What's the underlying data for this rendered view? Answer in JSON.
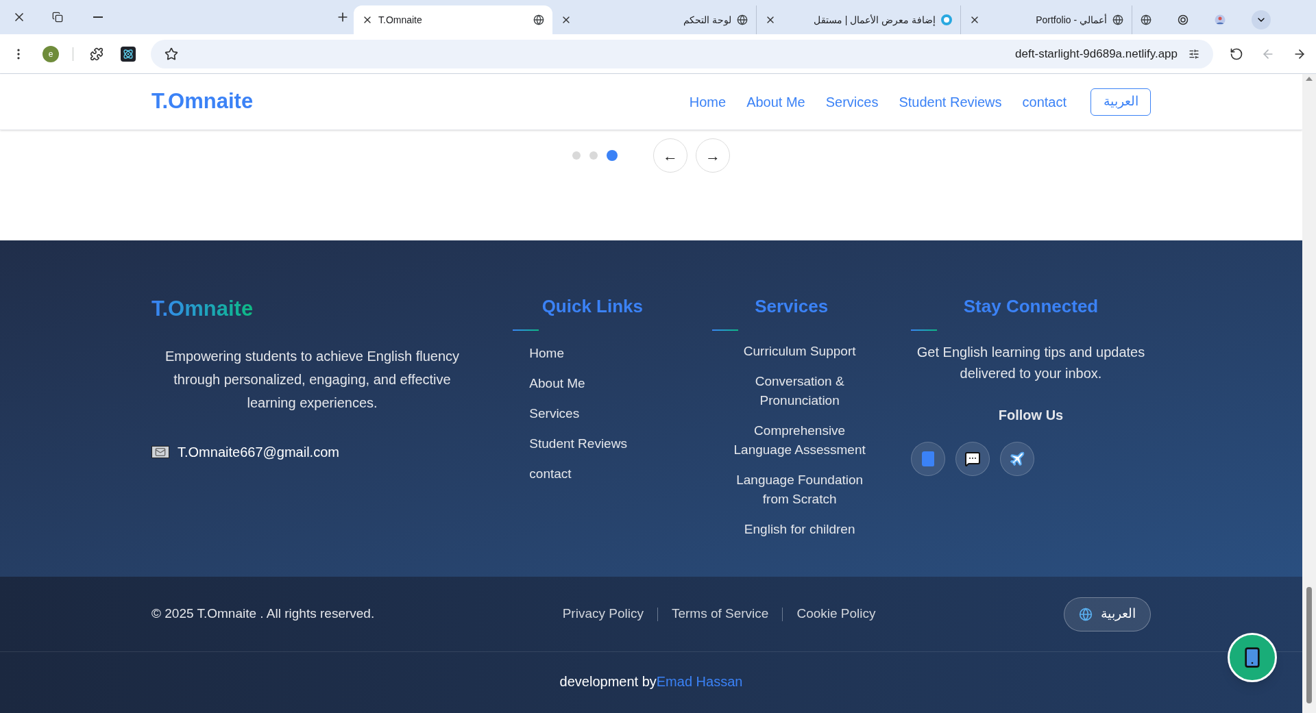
{
  "browser": {
    "tabs": [
      {
        "title": "T.Omnaite",
        "selected": true,
        "kind": "globe"
      },
      {
        "title": "لوحة التحكم",
        "selected": false,
        "kind": "globe"
      },
      {
        "title": "إضافة معرض الأعمال | مستقل",
        "selected": false,
        "kind": "ring"
      },
      {
        "title": "أعمالي - Portfolio",
        "selected": false,
        "kind": "globe"
      }
    ],
    "profile_initial": "e",
    "url": "deft-starlight-9d689a.netlify.app",
    "history_buttons": [
      {
        "kind": "forward",
        "disabled": true
      },
      {
        "kind": "back",
        "disabled": false
      }
    ]
  },
  "navbar": {
    "logo": "T.Omnaite",
    "links": [
      "Home",
      "About Me",
      "Services",
      "Student Reviews",
      "contact"
    ],
    "language_button": "العربية"
  },
  "carousel": {
    "dots": [
      {
        "selected": false
      },
      {
        "selected": false
      },
      {
        "selected": true
      }
    ],
    "buttons": [
      "←",
      "→"
    ]
  },
  "footer": {
    "brand": "T.Omnaite",
    "description": "Empowering students to achieve English fluency through personalized, engaging, and effective learning experiences.",
    "email": "T.Omnaite667@gmail.com",
    "quick_links": {
      "title": "Quick Links",
      "items": [
        "Home",
        "About Me",
        "Services",
        "Student Reviews",
        "contact"
      ]
    },
    "services": {
      "title": "Services",
      "items": [
        "Curriculum Support",
        "Conversation & Pronunciation",
        "Comprehensive Language Assessment",
        "Language Foundation from Scratch",
        "English for children"
      ]
    },
    "stay_connected": {
      "title": "Stay Connected",
      "text": "Get English learning tips and updates delivered to your inbox.",
      "follow_title": "Follow Us"
    },
    "copyright": "© 2025 T.Omnaite . All rights reserved.",
    "policy_links": [
      "Privacy Policy",
      "Terms of Service",
      "Cookie Policy"
    ],
    "language_button": "العربية",
    "credit": "development by",
    "credit_author": "Emad Hassan"
  }
}
